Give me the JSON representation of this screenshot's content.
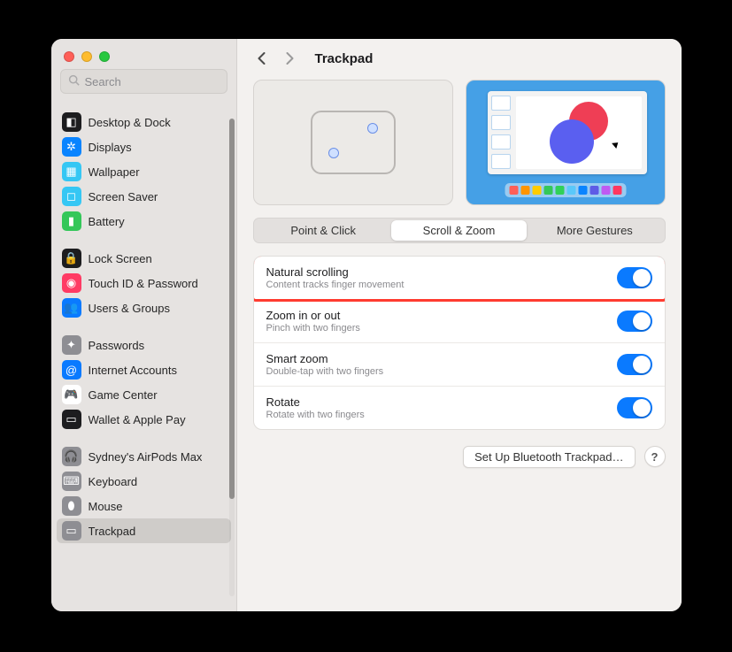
{
  "search": {
    "placeholder": "Search"
  },
  "sidebar": {
    "groups": [
      [
        {
          "label": "Desktop & Dock",
          "bg": "#1d1d1f",
          "glyph": "◧"
        },
        {
          "label": "Displays",
          "bg": "#0a84ff",
          "glyph": "✲"
        },
        {
          "label": "Wallpaper",
          "bg": "#35c7f4",
          "glyph": "▦"
        },
        {
          "label": "Screen Saver",
          "bg": "#35c7f4",
          "glyph": "◻"
        },
        {
          "label": "Battery",
          "bg": "#34c759",
          "glyph": "▮"
        }
      ],
      [
        {
          "label": "Lock Screen",
          "bg": "#1d1d1f",
          "glyph": "🔒"
        },
        {
          "label": "Touch ID & Password",
          "bg": "#ff3b64",
          "glyph": "◉"
        },
        {
          "label": "Users & Groups",
          "bg": "#0a7aff",
          "glyph": "👥"
        }
      ],
      [
        {
          "label": "Passwords",
          "bg": "#8e8e93",
          "glyph": "✦"
        },
        {
          "label": "Internet Accounts",
          "bg": "#0a7aff",
          "glyph": "@"
        },
        {
          "label": "Game Center",
          "bg": "#ffffff",
          "glyph": "🎮",
          "fg": "#ff3b64"
        },
        {
          "label": "Wallet & Apple Pay",
          "bg": "#1d1d1f",
          "glyph": "▭"
        }
      ],
      [
        {
          "label": "Sydney's AirPods Max",
          "bg": "#8e8e93",
          "glyph": "🎧"
        },
        {
          "label": "Keyboard",
          "bg": "#8e8e93",
          "glyph": "⌨"
        },
        {
          "label": "Mouse",
          "bg": "#8e8e93",
          "glyph": "⬮"
        },
        {
          "label": "Trackpad",
          "bg": "#8e8e93",
          "glyph": "▭",
          "selected": true
        }
      ]
    ]
  },
  "header": {
    "title": "Trackpad"
  },
  "tabs": [
    {
      "label": "Point & Click"
    },
    {
      "label": "Scroll & Zoom",
      "active": true
    },
    {
      "label": "More Gestures"
    }
  ],
  "settings": [
    {
      "title": "Natural scrolling",
      "sub": "Content tracks finger movement",
      "on": true,
      "highlight": true
    },
    {
      "title": "Zoom in or out",
      "sub": "Pinch with two fingers",
      "on": true
    },
    {
      "title": "Smart zoom",
      "sub": "Double-tap with two fingers",
      "on": true
    },
    {
      "title": "Rotate",
      "sub": "Rotate with two fingers",
      "on": true
    }
  ],
  "footer": {
    "bluetooth": "Set Up Bluetooth Trackpad…",
    "help": "?"
  },
  "dock_colors": [
    "#ff5f57",
    "#ff9500",
    "#ffcc00",
    "#34c759",
    "#30d158",
    "#5ac8fa",
    "#0a84ff",
    "#5e5ce6",
    "#bf5af2",
    "#ff375f"
  ]
}
